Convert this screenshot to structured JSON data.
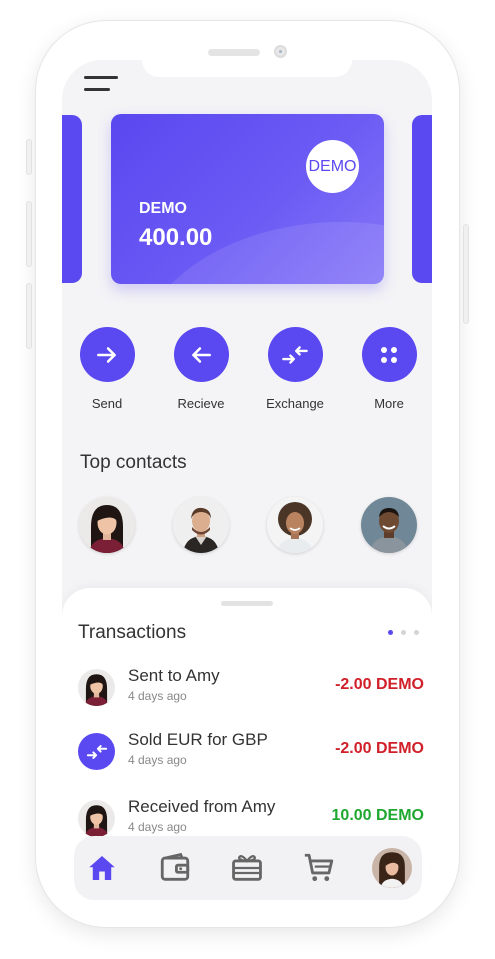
{
  "card": {
    "badge": "DEMO",
    "currency": "DEMO",
    "balance": "400.00",
    "accent_color": "#5a48f0"
  },
  "actions": [
    {
      "label": "Send",
      "icon": "arrow-right-icon"
    },
    {
      "label": "Recieve",
      "icon": "arrow-left-icon"
    },
    {
      "label": "Exchange",
      "icon": "exchange-icon"
    },
    {
      "label": "More",
      "icon": "grid-dots-icon"
    }
  ],
  "contacts": {
    "title": "Top contacts"
  },
  "transactions": {
    "title": "Transactions",
    "items": [
      {
        "name": "Sent to Amy",
        "date": "4 days ago",
        "amount": "-2.00 DEMO",
        "icon": "avatar-amy"
      },
      {
        "name": "Sold EUR for GBP",
        "date": "4 days ago",
        "amount": "-2.00 DEMO",
        "icon": "exchange-icon"
      },
      {
        "name": "Received from Amy",
        "date": "4 days ago",
        "amount": "10.00 DEMO",
        "icon": "avatar-amy"
      }
    ],
    "negative_color": "#d0202a",
    "positive_color": "#1fa82f"
  },
  "nav": {
    "items": [
      "home-icon",
      "wallet-icon",
      "gift-card-icon",
      "cart-icon",
      "profile-avatar"
    ],
    "active_color": "#5a48f0",
    "inactive_color": "#666666"
  }
}
